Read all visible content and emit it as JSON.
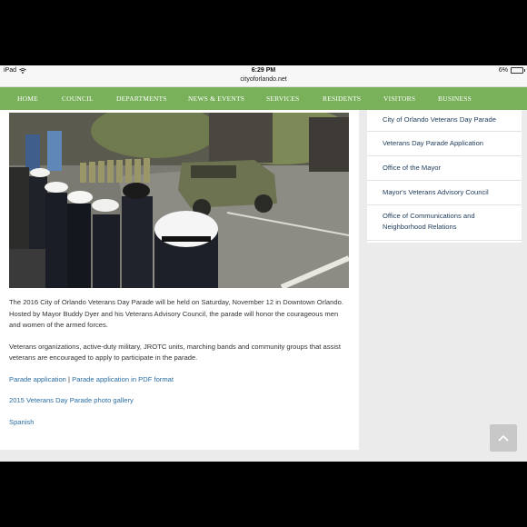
{
  "status_bar": {
    "device": "iPad",
    "time": "6:29 PM",
    "battery": "6%"
  },
  "url_bar": {
    "url": "cityoforlando.net"
  },
  "nav": {
    "items": [
      "HOME",
      "COUNCIL",
      "DEPARTMENTS",
      "NEWS & EVENTS",
      "SERVICES",
      "RESIDENTS",
      "VISITORS",
      "BUSINESS"
    ]
  },
  "article": {
    "paragraph1": "The 2016 City of Orlando Veterans Day Parade will be held on Saturday, November 12 in Downtown Orlando. Hosted by Mayor Buddy Dyer and his Veterans Advisory Council, the parade will honor the courageous men and women of the armed forces.",
    "paragraph2": "Veterans organizations, active-duty military, JROTC units, marching bands and community groups that assist veterans are encouraged to apply to participate in the parade.",
    "link_parade_application": "Parade application",
    "separator": "|",
    "link_parade_pdf": "Parade application in PDF format",
    "link_photo_gallery": "2015 Veterans Day Parade photo gallery",
    "link_spanish": "Spanish"
  },
  "sidebar": {
    "items": [
      "City of Orlando Veterans Day Parade",
      "Veterans Day Parade Application",
      "Office of the Mayor",
      "Mayor's Veterans Advisory Council",
      "Office of Communications and Neighborhood Relations"
    ]
  },
  "colors": {
    "nav_bg": "#79b15a",
    "link": "#2b6ea3",
    "sidebar_link": "#1d3b5a"
  },
  "icons": {
    "wifi": "wifi-icon",
    "battery": "battery-icon",
    "scroll_top": "chevron-up-icon"
  }
}
